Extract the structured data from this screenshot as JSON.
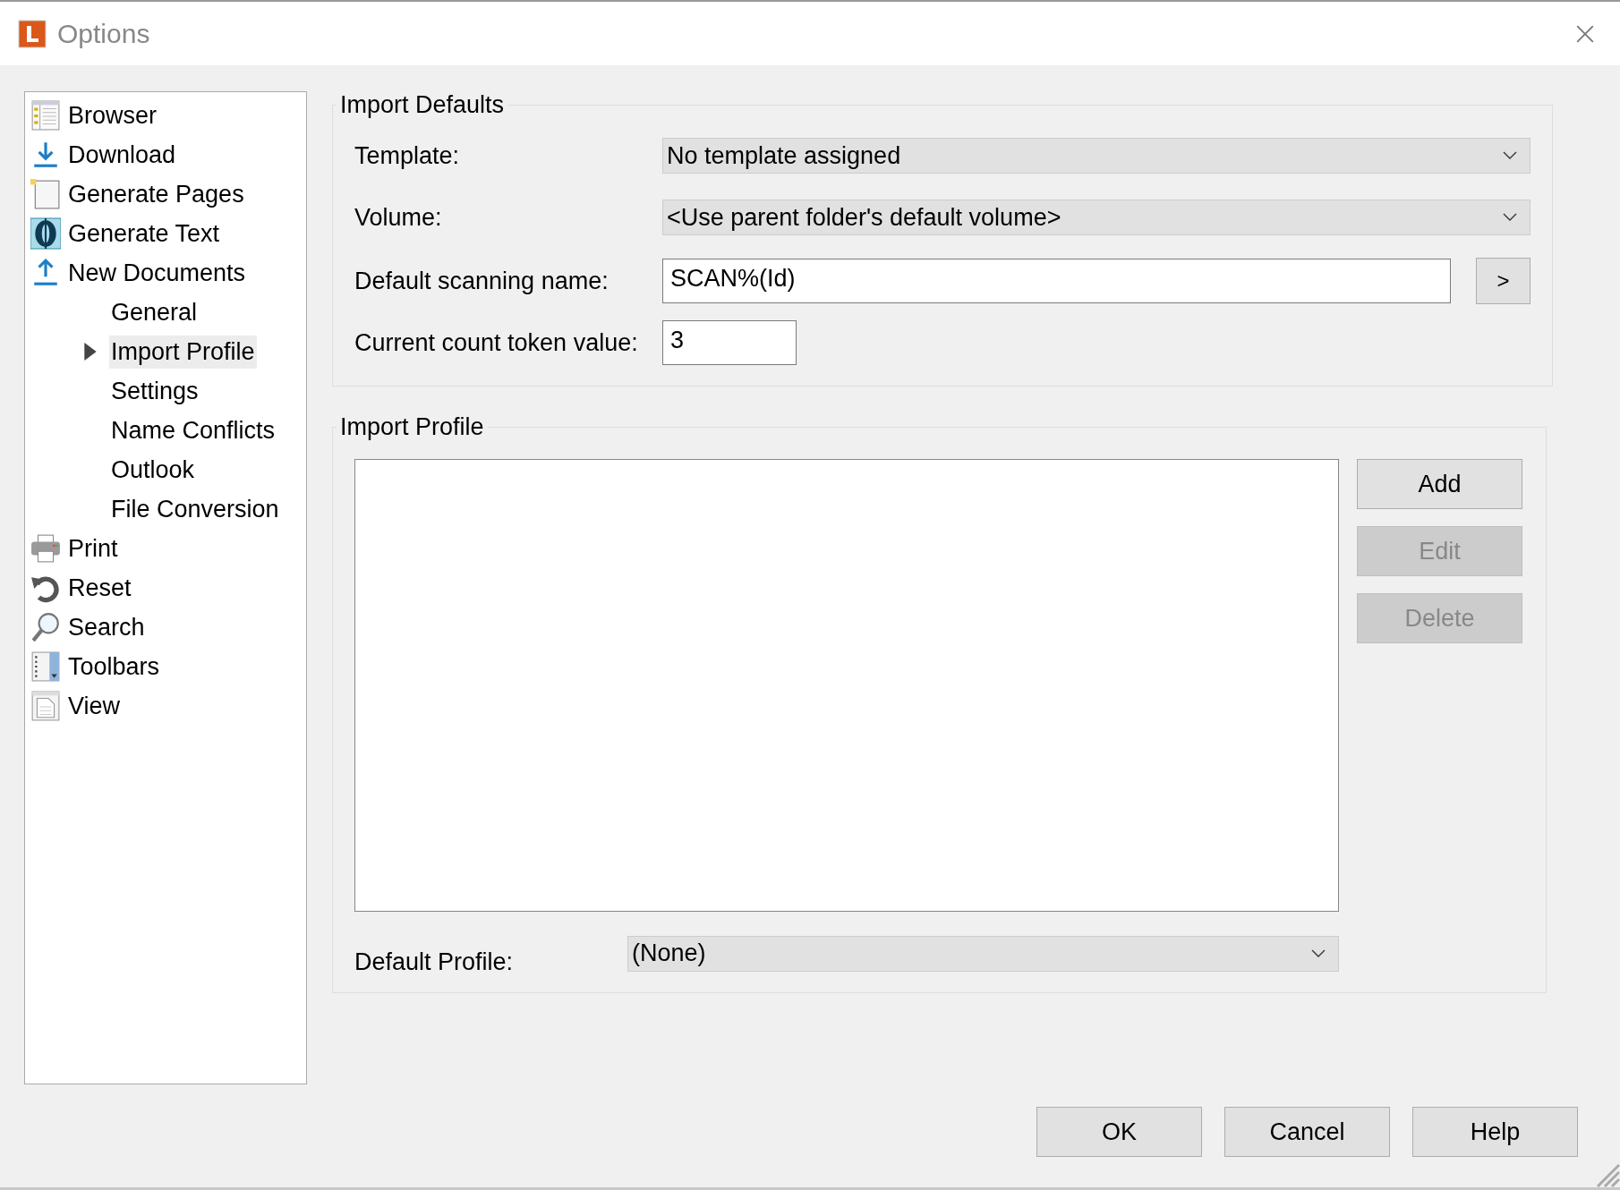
{
  "window": {
    "title": "Options"
  },
  "sidebar": {
    "items": [
      {
        "label": "Browser",
        "selected": false
      },
      {
        "label": "Download",
        "selected": false
      },
      {
        "label": "Generate Pages",
        "selected": false
      },
      {
        "label": "Generate Text",
        "selected": false
      },
      {
        "label": "New Documents",
        "selected": false,
        "children": [
          {
            "label": "General",
            "selected": false
          },
          {
            "label": "Import Profile",
            "selected": true
          },
          {
            "label": "Settings",
            "selected": false
          },
          {
            "label": "Name Conflicts",
            "selected": false
          },
          {
            "label": "Outlook",
            "selected": false
          },
          {
            "label": "File Conversion",
            "selected": false
          }
        ]
      },
      {
        "label": "Print",
        "selected": false
      },
      {
        "label": "Reset",
        "selected": false
      },
      {
        "label": "Search",
        "selected": false
      },
      {
        "label": "Toolbars",
        "selected": false
      },
      {
        "label": "View",
        "selected": false
      }
    ]
  },
  "import_defaults": {
    "title": "Import Defaults",
    "template": {
      "label": "Template:",
      "value": "No template assigned"
    },
    "volume": {
      "label": "Volume:",
      "value": "<Use parent folder's default volume>"
    },
    "scanning_name": {
      "label": "Default scanning name:",
      "value": "SCAN%(Id)",
      "button": ">"
    },
    "count_token": {
      "label": "Current count token value:",
      "value": "3"
    }
  },
  "import_profile": {
    "title": "Import Profile",
    "buttons": [
      {
        "label": "Add",
        "disabled": false
      },
      {
        "label": "Edit",
        "disabled": true
      },
      {
        "label": "Delete",
        "disabled": true
      }
    ],
    "default_profile": {
      "label": "Default Profile:",
      "value": "(None)"
    }
  },
  "buttons": [
    "OK",
    "Cancel",
    "Help"
  ]
}
